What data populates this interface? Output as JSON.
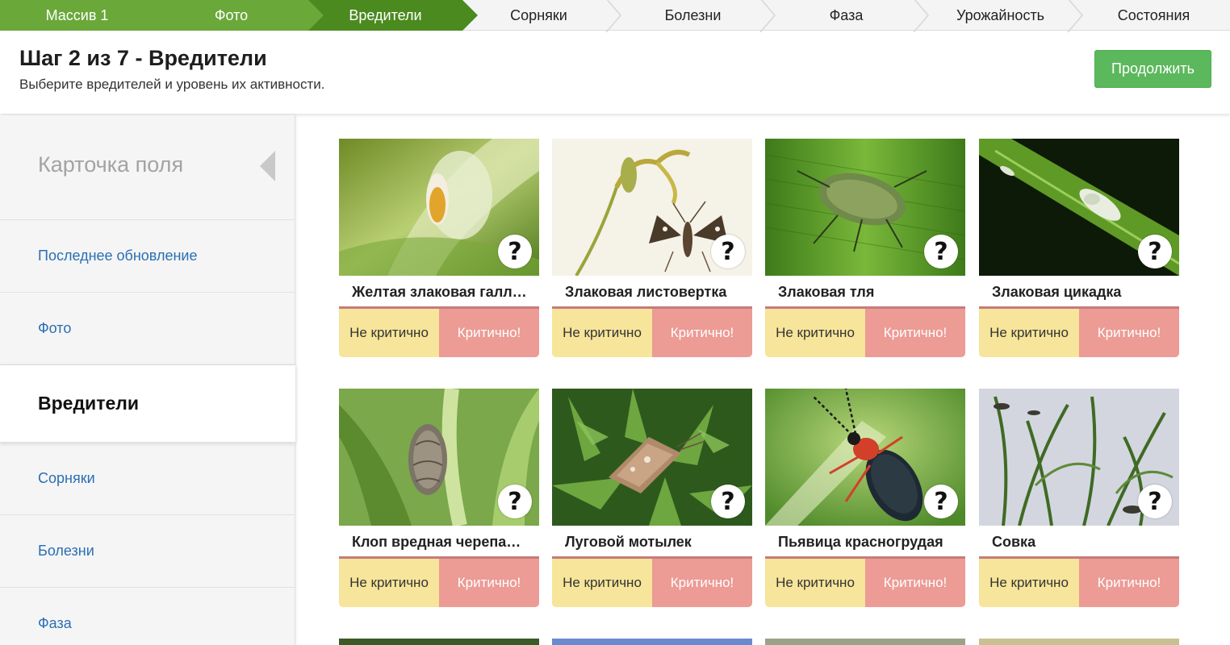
{
  "steps": [
    {
      "label": "Массив 1",
      "state": "done"
    },
    {
      "label": "Фото",
      "state": "done"
    },
    {
      "label": "Вредители",
      "state": "active"
    },
    {
      "label": "Сорняки",
      "state": "todo"
    },
    {
      "label": "Болезни",
      "state": "todo"
    },
    {
      "label": "Фаза",
      "state": "todo"
    },
    {
      "label": "Урожайность",
      "state": "todo"
    },
    {
      "label": "Состояния",
      "state": "todo"
    }
  ],
  "header": {
    "title": "Шаг 2 из 7 - Вредители",
    "subtitle": "Выберите вредителей и уровень их активности.",
    "continue_label": "Продолжить"
  },
  "sidebar": {
    "card_title": "Карточка поля",
    "items": [
      {
        "label": "Последнее обновление"
      },
      {
        "label": "Фото"
      },
      {
        "label": "Вредители",
        "active": true
      },
      {
        "label": "Сорняки"
      },
      {
        "label": "Болезни"
      },
      {
        "label": "Фаза"
      }
    ]
  },
  "options": {
    "low": "Не критично",
    "high": "Критично!"
  },
  "help_glyph": "?",
  "pests": [
    {
      "name": "Желтая злаковая галл…",
      "image": "gall-midge-photo",
      "colors": [
        "#8a9a3a",
        "#c8d47a"
      ]
    },
    {
      "name": "Злаковая листовертка",
      "image": "leaf-roller-illustration",
      "colors": [
        "#f3efe2",
        "#9aa64a"
      ]
    },
    {
      "name": "Злаковая тля",
      "image": "aphid-photo",
      "colors": [
        "#3f7a1f",
        "#7fbf3f"
      ]
    },
    {
      "name": "Злаковая цикадка",
      "image": "leafhopper-photo",
      "colors": [
        "#0f1f0a",
        "#6ea62f"
      ]
    },
    {
      "name": "Клоп вредная черепа…",
      "image": "shield-bug-photo",
      "colors": [
        "#5b8a3a",
        "#b6d48a"
      ]
    },
    {
      "name": "Луговой мотылек",
      "image": "meadow-moth-photo",
      "colors": [
        "#2f5a1f",
        "#79a84a"
      ]
    },
    {
      "name": "Пьявица красногрудая",
      "image": "leaf-beetle-photo",
      "colors": [
        "#4a8a2a",
        "#a8d46a"
      ]
    },
    {
      "name": "Совка",
      "image": "cutworm-damage-photo",
      "colors": [
        "#c9ccd6",
        "#5a7a3a"
      ]
    }
  ]
}
